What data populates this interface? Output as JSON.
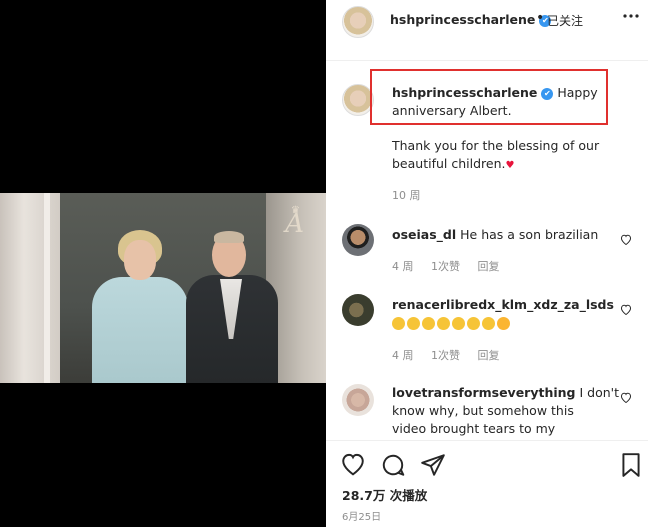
{
  "header": {
    "username": "hshprincesscharlene",
    "verified_icon": "verified-badge-icon",
    "separator": "•",
    "follow_label": "已关注",
    "more_icon": "more-options-icon"
  },
  "caption": {
    "username": "hshprincesscharlene",
    "text_line1": "Happy",
    "text_line2": "anniversary Albert.",
    "body_line1": "Thank you for the blessing of our",
    "body_line2": "beautiful children.",
    "time": "10 周"
  },
  "comments": [
    {
      "username": "oseias_dl",
      "text": "He has a son brazilian",
      "time": "4 周",
      "likes": "1次赞",
      "reply": "回复"
    },
    {
      "username": "renacerlibredx_klm_xdz_za_lsds",
      "text": "",
      "emoji_count": 8,
      "time": "4 周",
      "likes": "1次赞",
      "reply": "回复"
    },
    {
      "username": "lovetransformseverything",
      "text_line1": "I don't",
      "text_line2": "know why, but somehow this",
      "text_line3": "video brought tears to my"
    }
  ],
  "footer": {
    "views_count": "28.7万",
    "views_label": "次播放",
    "date": "6月25日"
  },
  "media": {
    "watermark": "A"
  }
}
